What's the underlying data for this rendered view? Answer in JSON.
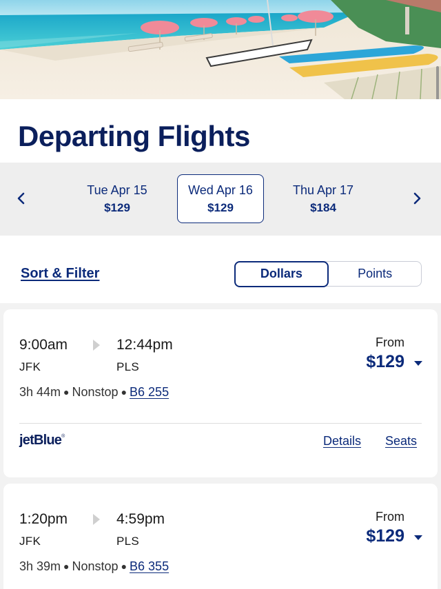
{
  "hero": {
    "image": "beach-scene"
  },
  "page_title": "Departing Flights",
  "date_nav": {
    "prev_icon": "chevron-left-icon",
    "next_icon": "chevron-right-icon",
    "dates": [
      {
        "label": "Tue Apr 15",
        "price": "$129",
        "selected": false
      },
      {
        "label": "Wed Apr 16",
        "price": "$129",
        "selected": true
      },
      {
        "label": "Thu Apr 17",
        "price": "$184",
        "selected": false
      }
    ]
  },
  "sort_filter_label": "Sort & Filter",
  "currency_toggle": {
    "options": [
      "Dollars",
      "Points"
    ],
    "selected": "Dollars"
  },
  "flights": [
    {
      "depart_time": "9:00am",
      "arrive_time": "12:44pm",
      "origin": "JFK",
      "destination": "PLS",
      "duration": "3h 44m",
      "stops": "Nonstop",
      "flight_number": "B6 255",
      "from_label": "From",
      "price": "$129",
      "airline": "jetBlue",
      "details_label": "Details",
      "seats_label": "Seats"
    },
    {
      "depart_time": "1:20pm",
      "arrive_time": "4:59pm",
      "origin": "JFK",
      "destination": "PLS",
      "duration": "3h 39m",
      "stops": "Nonstop",
      "flight_number": "B6 355",
      "from_label": "From",
      "price": "$129"
    }
  ],
  "colors": {
    "brand_navy": "#0b2a7a",
    "title_navy": "#0b1f5c"
  }
}
